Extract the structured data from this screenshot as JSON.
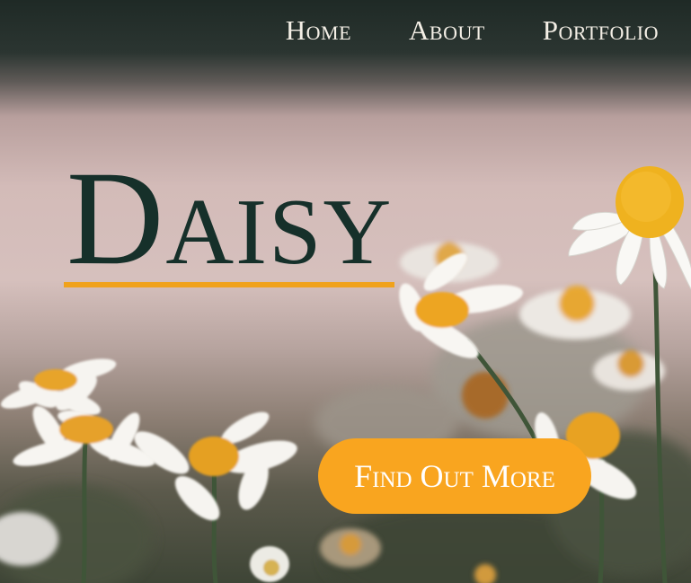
{
  "nav": {
    "items": [
      {
        "label": "Home"
      },
      {
        "label": "About"
      },
      {
        "label": "Portfolio"
      }
    ]
  },
  "hero": {
    "title": "Daisy",
    "cta_label": "Find Out More"
  },
  "colors": {
    "accent": "#f9a51f",
    "title": "#16302a",
    "nav_text": "#f4efe6"
  }
}
